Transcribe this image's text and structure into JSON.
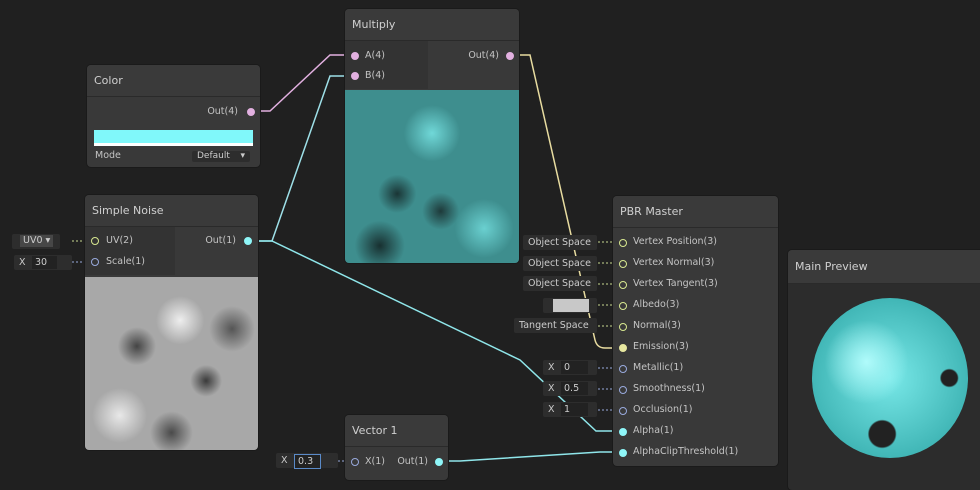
{
  "colors": {
    "bg": "#202020",
    "node": "#393939",
    "cyan": "#8ff6f8",
    "pink": "#e2b0e0",
    "yellow": "#e8e8a0"
  },
  "color_node": {
    "title": "Color",
    "out": "Out(4)",
    "swatch": "#80f8fa",
    "mode_label": "Mode",
    "mode_value": "Default"
  },
  "noise_node": {
    "title": "Simple Noise",
    "inputs": [
      "UV(2)",
      "Scale(1)"
    ],
    "out": "Out(1)",
    "uv_value": "UV0",
    "scale_axis": "X",
    "scale_value": "30"
  },
  "multiply_node": {
    "title": "Multiply",
    "inputs": [
      "A(4)",
      "B(4)"
    ],
    "out": "Out(4)"
  },
  "vector1_node": {
    "title": "Vector 1",
    "input": "X(1)",
    "out": "Out(1)",
    "axis": "X",
    "value": "0.3"
  },
  "pbr_node": {
    "title": "PBR Master",
    "ports": [
      "Vertex Position(3)",
      "Vertex Normal(3)",
      "Vertex Tangent(3)",
      "Albedo(3)",
      "Normal(3)",
      "Emission(3)",
      "Metallic(1)",
      "Smoothness(1)",
      "Occlusion(1)",
      "Alpha(1)",
      "AlphaClipThreshold(1)"
    ],
    "defaults": [
      "Object Space",
      "Object Space",
      "Object Space",
      "",
      "Tangent Space"
    ],
    "floats": [
      {
        "axis": "X",
        "value": "0"
      },
      {
        "axis": "X",
        "value": "0.5"
      },
      {
        "axis": "X",
        "value": "1"
      }
    ]
  },
  "preview": {
    "title": "Main Preview"
  }
}
